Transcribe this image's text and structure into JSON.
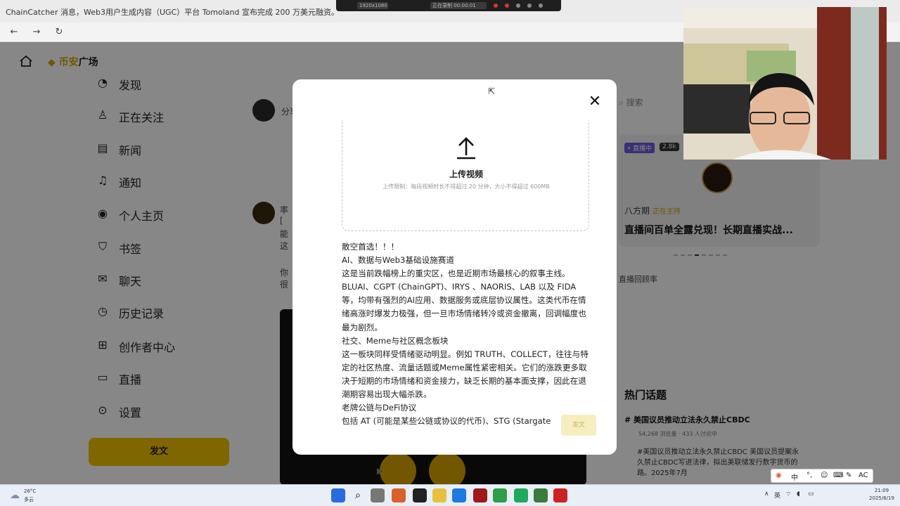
{
  "browser": {
    "tab_title": "ChainCatcher 消息，Web3用户生成内容（UGC）平台 Tomoland 宣布完成 200 万美元融资。",
    "recording": {
      "resolution": "1920x1080",
      "status": "正在录制 00:00:01"
    }
  },
  "app": {
    "logo_brand": "币安",
    "logo_suffix": "广场",
    "sidebar": [
      {
        "label": "发现",
        "icon": "discover-icon"
      },
      {
        "label": "正在关注",
        "icon": "following-icon"
      },
      {
        "label": "新闻",
        "icon": "news-icon"
      },
      {
        "label": "通知",
        "icon": "bell-icon"
      },
      {
        "label": "个人主页",
        "icon": "profile-icon"
      },
      {
        "label": "书签",
        "icon": "bookmark-icon"
      },
      {
        "label": "聊天",
        "icon": "chat-icon"
      },
      {
        "label": "历史记录",
        "icon": "history-icon"
      },
      {
        "label": "创作者中心",
        "icon": "creator-icon"
      },
      {
        "label": "直播",
        "icon": "live-icon"
      },
      {
        "label": "设置",
        "icon": "settings-icon"
      }
    ],
    "post_button": "发文",
    "feed_fragments": [
      "分享",
      "率",
      "[",
      "能",
      "这",
      "你",
      "很"
    ],
    "right": {
      "search_placeholder": "搜索",
      "live_badge": "• 直播中",
      "live_count": "2.8k",
      "host_name": "八方期",
      "host_tag": "正在主持",
      "live_title": "直播间百单全露兑现！长期直播实战...",
      "image_alt": "直播回顾率",
      "hot_title": "热门话题",
      "topic_name": "# 美国议员推动立法永久禁止CBDC",
      "topic_meta": "54,268 浏览量 · 433 人讨论中",
      "topic_desc": "#美国议员推动立法永久禁止CBDC 美国议员提案永久禁止CBDC写进法律，拟出美联储发行数字货币的路。2025年7月"
    }
  },
  "modal": {
    "upload_title": "上传视频",
    "upload_hint": "上传限制：每段视频时长不得超过 20 分钟，大小不得超过 600MB",
    "post_lines": [
      "散空首选！！！",
      "AI、数据与Web3基础设施赛道",
      "这是当前跌幅榜上的重灾区，也是近期市场最核心的叙事主线。BLUAI、CGPT (ChainGPT)、IRYS 、NAORIS、LAB 以及 FIDA 等，均带有强烈的AI应用、数据服务或底层协议属性。这类代币在情绪高涨时爆发力极强，但一旦市场情绪转冷或资金撤离，回调幅度也最为剧烈。",
      "社交、Meme与社区概念板块",
      "这一板块同样受情绪驱动明显。例如 TRUTH、COLLECT，往往与特定的社区热度、流量话题或Meme属性紧密相关。它们的涨跌更多取决于短期的市场情绪和资金接力，缺乏长期的基本面支撑，因此在退潮期容易出现大幅杀跌。",
      "老牌公链与DeFi协议",
      "包括 AT (可能是某些公链或协议的代币)、STG (Stargate"
    ],
    "submit": "发文"
  },
  "taskbar": {
    "weather_temp": "26°C",
    "weather_cond": "多云",
    "tray_lang": "中",
    "tray_ime": "英",
    "tray_extra": "AC",
    "time": "21:09",
    "date": "2025/6/19"
  }
}
